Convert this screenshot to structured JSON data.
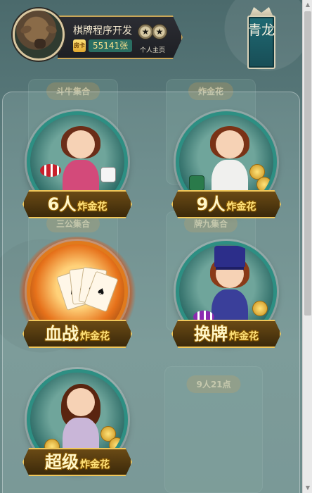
{
  "header": {
    "nickname": "棋牌程序开发",
    "card_icon_label": "房卡",
    "card_count": "55141张",
    "homepage_label": "个人主页",
    "dragon_label": "青龙"
  },
  "games": [
    {
      "main": "6人",
      "sub": "炸金花"
    },
    {
      "main": "9人",
      "sub": "炸金花"
    },
    {
      "main": "血战",
      "sub": "炸金花"
    },
    {
      "main": "换牌",
      "sub": "炸金花"
    },
    {
      "main": "超级",
      "sub": "炸金花"
    }
  ],
  "background_tiles": [
    "斗牛集合",
    "炸金花",
    "三公集合",
    "牌九集合",
    "9人21点"
  ],
  "colors": {
    "gold": "#f0c75a",
    "teal_ring": "#2d8f83",
    "banner_text": "#fff6c8"
  }
}
